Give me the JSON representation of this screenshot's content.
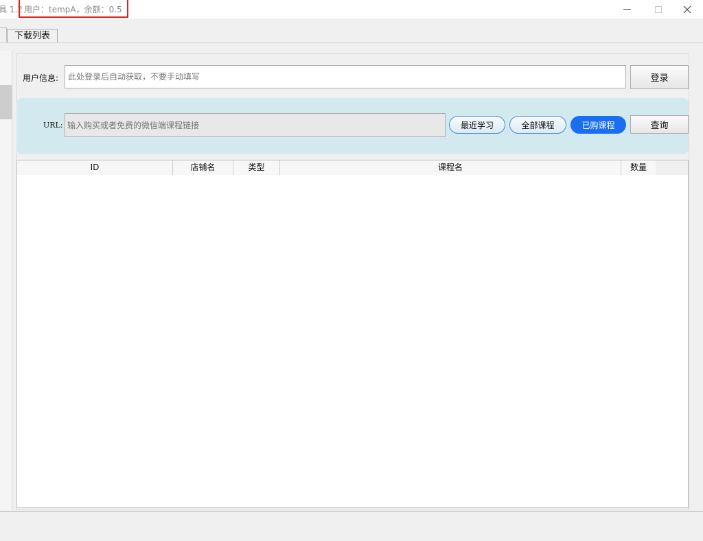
{
  "window": {
    "title_prefix": "具 1.2",
    "title_user": "用户：tempA，余额：0.5"
  },
  "tabs": [
    {
      "label": "下载列表"
    }
  ],
  "user_info": {
    "label": "用户信息:",
    "placeholder": "此处登录后自动获取，不要手动填写",
    "login_label": "登录"
  },
  "url": {
    "label": "URL:",
    "placeholder": "输入购买或者免费的微信端课程链接",
    "recent_label": "最近学习",
    "all_label": "全部课程",
    "bought_label": "已购课程",
    "query_label": "查询"
  },
  "table": {
    "columns": [
      "ID",
      "店铺名",
      "类型",
      "课程名",
      "数量"
    ],
    "rows": []
  },
  "colors": {
    "highlight_border": "#e0201c",
    "url_band": "#d3e9f0",
    "active_pill": "#1a6ef0"
  }
}
